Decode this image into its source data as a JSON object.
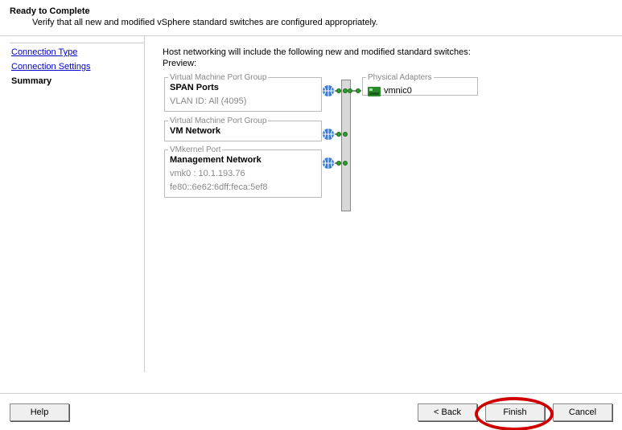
{
  "header": {
    "title": "Ready to Complete",
    "subtitle": "Verify that all new and modified vSphere standard switches are configured appropriately."
  },
  "steps": {
    "connection_type": "Connection Type",
    "connection_settings": "Connection Settings",
    "summary": "Summary"
  },
  "content": {
    "intro": "Host networking will include the following new and modified standard switches:",
    "preview_label": "Preview:"
  },
  "portgroups": [
    {
      "legend": "Virtual Machine Port Group",
      "name": "SPAN Ports",
      "meta": [
        "VLAN ID: All (4095)"
      ]
    },
    {
      "legend": "Virtual Machine Port Group",
      "name": "VM Network",
      "meta": []
    },
    {
      "legend": "VMkernel Port",
      "name": "Management Network",
      "meta": [
        "vmk0 : 10.1.193.76",
        "fe80::6e62:6dff:feca:5ef8"
      ]
    }
  ],
  "adapters": {
    "legend": "Physical Adapters",
    "items": [
      "vmnic0"
    ]
  },
  "footer": {
    "help": "Help",
    "back": "< Back",
    "finish": "Finish",
    "cancel": "Cancel"
  }
}
